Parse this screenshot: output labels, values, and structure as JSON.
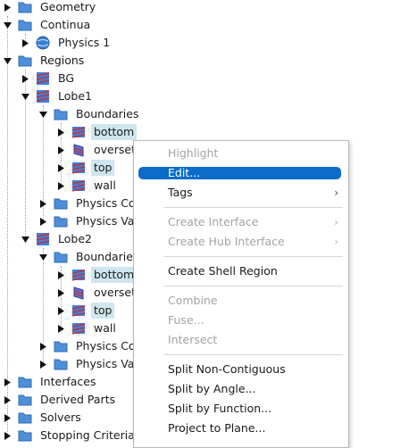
{
  "tree": {
    "items": [
      {
        "label": "Geometry",
        "expanded": false,
        "icon": "folder-icon"
      },
      {
        "label": "Continua",
        "expanded": true,
        "icon": "folder-icon"
      },
      {
        "label": "Physics 1",
        "expanded": false,
        "icon": "physics-sphere-icon"
      },
      {
        "label": "Regions",
        "expanded": true,
        "icon": "folder-icon"
      },
      {
        "label": "BG",
        "expanded": false,
        "icon": "region-icon"
      },
      {
        "label": "Lobe1",
        "expanded": true,
        "icon": "region-icon"
      },
      {
        "label": "Boundaries",
        "expanded": true,
        "icon": "folder-icon"
      },
      {
        "label": "bottom",
        "expanded": false,
        "icon": "boundary-wall-icon",
        "selected": true
      },
      {
        "label": "overset",
        "expanded": false,
        "icon": "boundary-overset-icon"
      },
      {
        "label": "top",
        "expanded": false,
        "icon": "boundary-wall-icon",
        "selected": true
      },
      {
        "label": "wall",
        "expanded": false,
        "icon": "boundary-wall-icon"
      },
      {
        "label": "Physics Co",
        "expanded": false,
        "icon": "folder-icon"
      },
      {
        "label": "Physics Val",
        "expanded": false,
        "icon": "folder-icon"
      },
      {
        "label": "Lobe2",
        "expanded": true,
        "icon": "region-icon"
      },
      {
        "label": "Boundaries",
        "expanded": true,
        "icon": "folder-icon"
      },
      {
        "label": "bottom",
        "expanded": false,
        "icon": "boundary-wall-icon",
        "selected": true
      },
      {
        "label": "overset",
        "expanded": false,
        "icon": "boundary-overset-icon"
      },
      {
        "label": "top",
        "expanded": false,
        "icon": "boundary-wall-icon",
        "selected": true
      },
      {
        "label": "wall",
        "expanded": false,
        "icon": "boundary-wall-icon"
      },
      {
        "label": "Physics Co",
        "expanded": false,
        "icon": "folder-icon"
      },
      {
        "label": "Physics Val",
        "expanded": false,
        "icon": "folder-icon"
      },
      {
        "label": "Interfaces",
        "expanded": false,
        "icon": "folder-icon"
      },
      {
        "label": "Derived Parts",
        "expanded": false,
        "icon": "folder-icon"
      },
      {
        "label": "Solvers",
        "expanded": false,
        "icon": "folder-icon"
      },
      {
        "label": "Stopping Criteria",
        "expanded": false,
        "icon": "folder-icon"
      }
    ]
  },
  "context_menu": {
    "items": [
      {
        "label": "Highlight",
        "disabled": true
      },
      {
        "label": "Edit...",
        "disabled": false,
        "highlighted": true
      },
      {
        "label": "Tags",
        "disabled": false,
        "submenu": true
      },
      {
        "label": "Create Interface",
        "disabled": true,
        "submenu": true
      },
      {
        "label": "Create Hub Interface",
        "disabled": true,
        "submenu": true
      },
      {
        "label": "Create Shell Region",
        "disabled": false
      },
      {
        "label": "Combine",
        "disabled": true
      },
      {
        "label": "Fuse...",
        "disabled": true
      },
      {
        "label": "Intersect",
        "disabled": true
      },
      {
        "label": "Split Non-Contiguous",
        "disabled": false
      },
      {
        "label": "Split by Angle...",
        "disabled": false
      },
      {
        "label": "Split by Function...",
        "disabled": false
      },
      {
        "label": "Project to Plane...",
        "disabled": false
      }
    ],
    "submenu_arrow": "›"
  },
  "colors": {
    "folder": "#4f8fd8",
    "selection": "#cfe6ee",
    "menu_highlight": "#0a6bc8",
    "disabled_text": "#a3a3a3"
  }
}
